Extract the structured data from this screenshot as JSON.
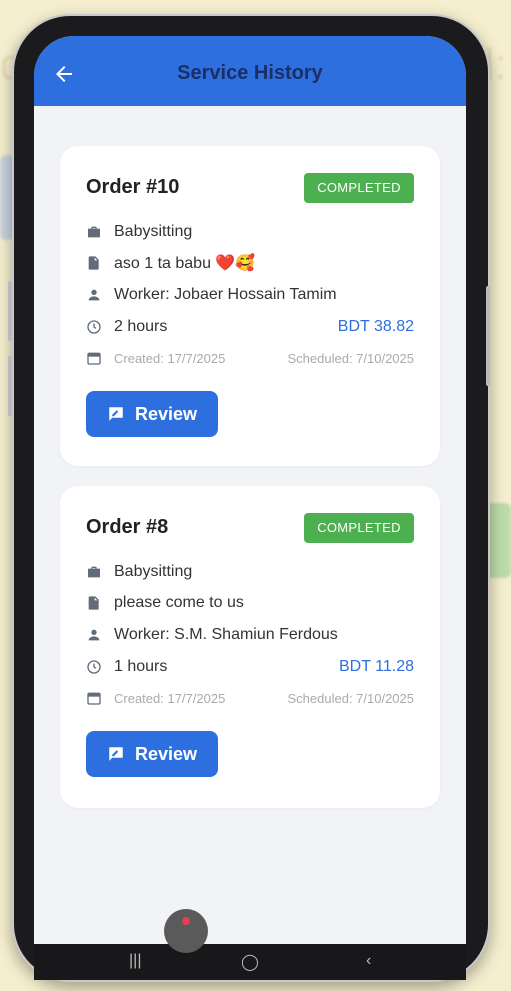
{
  "app": {
    "title": "Service History"
  },
  "orders": [
    {
      "order": "Order #10",
      "status": "COMPLETED",
      "service": "Babysitting",
      "note": "aso 1 ta babu ❤️🥰",
      "worker": "Worker: Jobaer Hossain Tamim",
      "duration": "2 hours",
      "price": "BDT 38.82",
      "created": "Created: 17/7/2025",
      "scheduled": "Scheduled: 7/10/2025",
      "review_label": "Review"
    },
    {
      "order": "Order #8",
      "status": "COMPLETED",
      "service": "Babysitting",
      "note": "please come to us",
      "worker": "Worker: S.M. Shamiun Ferdous",
      "duration": "1 hours",
      "price": "BDT 11.28",
      "created": "Created: 17/7/2025",
      "scheduled": "Scheduled: 7/10/2025",
      "review_label": "Review"
    }
  ],
  "colors": {
    "primary": "#2e6fe0",
    "status_completed": "#4caf50",
    "background": "#f2f3f7"
  },
  "icons": [
    "back-arrow-icon",
    "briefcase-icon",
    "document-icon",
    "person-icon",
    "clock-icon",
    "calendar-icon",
    "rate-review-icon"
  ],
  "nav": {
    "recents_glyph": "|||",
    "home_glyph": "◯",
    "back_glyph": "‹"
  }
}
